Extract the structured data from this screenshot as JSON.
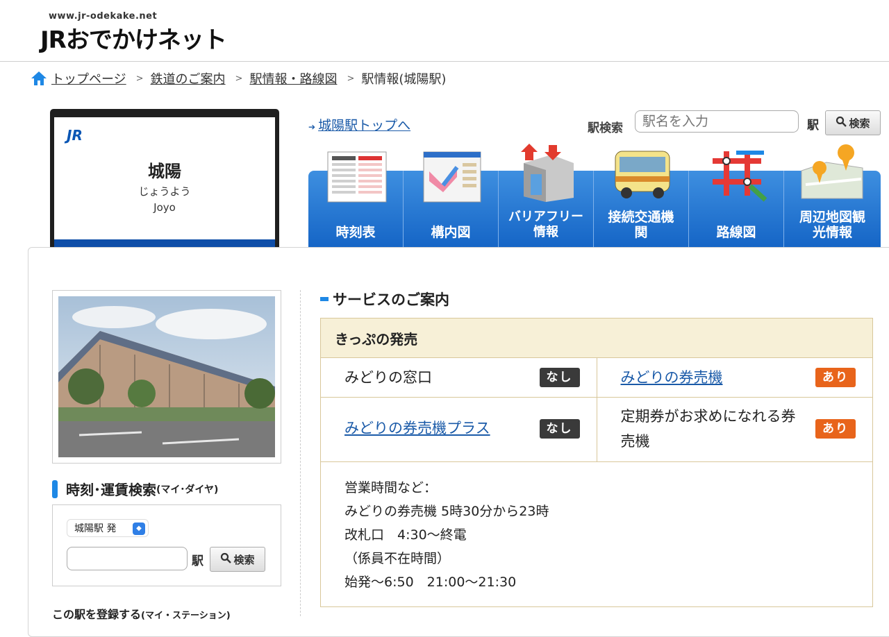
{
  "header": {
    "logo_url": "www.jr-odekake.net",
    "logo_text": "JRおでかけネット"
  },
  "breadcrumb": {
    "items": [
      "トップページ",
      "鉄道のご案内",
      "駅情報・路線図"
    ],
    "current": "駅情報(城陽駅)"
  },
  "station": {
    "logo": "JR",
    "name": "城陽",
    "kana": "じょうよう",
    "roman": "Joyo"
  },
  "top_link": "城陽駅トップへ",
  "search": {
    "label": "駅検索",
    "placeholder": "駅名を入力",
    "suffix": "駅",
    "button": "検索"
  },
  "tabs": [
    {
      "label": "時刻表",
      "icon": "timetable-icon"
    },
    {
      "label": "構内図",
      "icon": "station-map-icon"
    },
    {
      "label": "バリアフリー情報",
      "icon": "barrier-free-icon"
    },
    {
      "label": "接続交通機関",
      "icon": "bus-icon"
    },
    {
      "label": "路線図",
      "icon": "route-map-icon"
    },
    {
      "label": "周辺地図観光情報",
      "icon": "area-map-icon"
    }
  ],
  "sidebar": {
    "search_title": "時刻･運賃検索",
    "search_sub": "(マイ･ダイヤ)",
    "from_station": "城陽駅 発",
    "to_suffix": "駅",
    "button": "検索",
    "register": "この駅を登録する",
    "register_sub": "(マイ・ステーション)"
  },
  "services": {
    "title": "サービスのご案内",
    "section": "きっぷの発売",
    "rows": [
      [
        {
          "label": "みどりの窓口",
          "link": false,
          "status": "なし"
        },
        {
          "label": "みどりの券売機",
          "link": true,
          "status": "あり"
        }
      ],
      [
        {
          "label": "みどりの券売機プラス",
          "link": true,
          "status": "なし"
        },
        {
          "label": "定期券がお求めになれる券売機",
          "link": false,
          "status": "あり"
        }
      ]
    ],
    "notes": [
      "営業時間など：",
      "みどりの券売機 5時30分から23時",
      "改札口　4:30〜終電",
      "（係員不在時間）",
      "始発〜6:50　21:00〜21:30"
    ]
  },
  "colors": {
    "nav_blue": "#1565c6",
    "status_none": "#3a3a3a",
    "status_yes": "#e8641b",
    "table_border": "#d8c79a",
    "table_header": "#f7f0d7"
  }
}
